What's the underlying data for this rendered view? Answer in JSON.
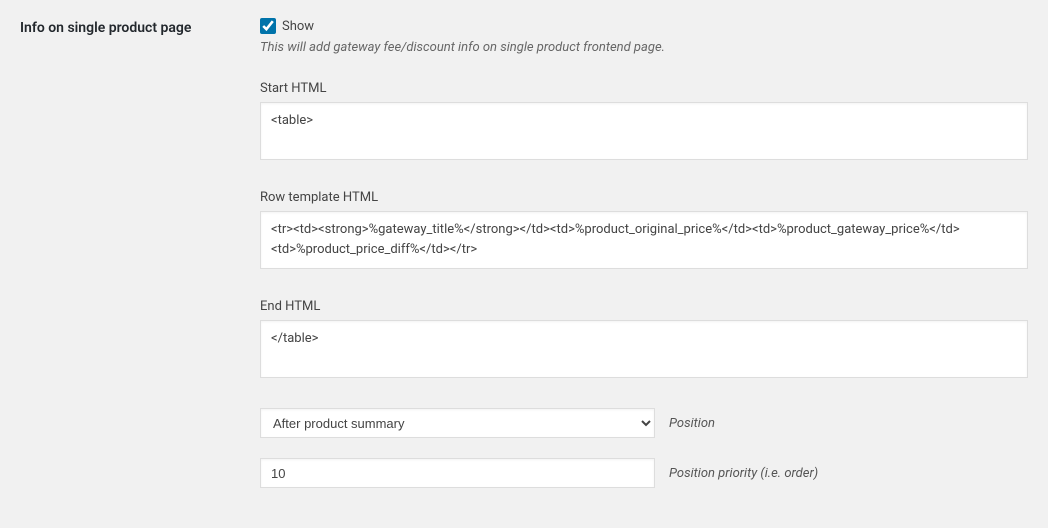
{
  "section": {
    "title": "Info on single product page"
  },
  "show": {
    "checked": true,
    "label": "Show",
    "description": "This will add gateway fee/discount info on single product frontend page."
  },
  "start_html": {
    "label": "Start HTML",
    "value": "<table>"
  },
  "row_template": {
    "label": "Row template HTML",
    "value": "<tr><td><strong>%gateway_title%</strong></td><td>%product_original_price%</td><td>%product_gateway_price%</td><td>%product_price_diff%</td></tr>"
  },
  "end_html": {
    "label": "End HTML",
    "value": "</table>"
  },
  "position": {
    "label": "Position",
    "selected": "After product summary"
  },
  "priority": {
    "label": "Position priority (i.e. order)",
    "value": "10"
  }
}
